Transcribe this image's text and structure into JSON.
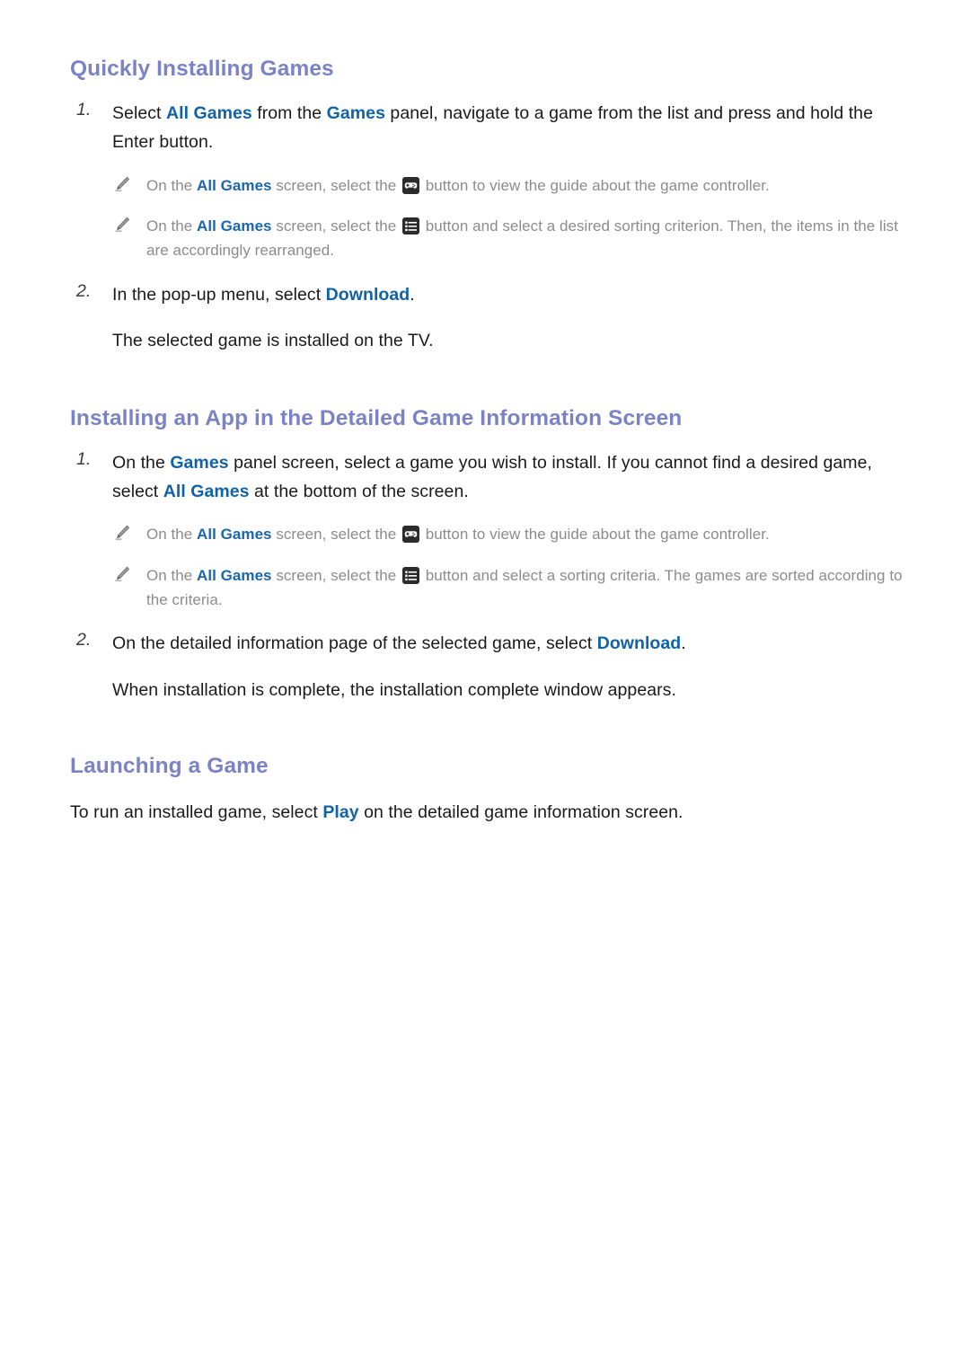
{
  "page": {
    "background": "#ffffff",
    "heading_color": "#7b83c6",
    "link_color": "#1063a8",
    "note_text_color": "#8c8c8c",
    "body_text_color": "#1a1a1a",
    "icon_background": "#2b2b2b"
  },
  "sections": [
    {
      "heading": "Quickly Installing Games",
      "steps": [
        {
          "marker": "1.",
          "parts": [
            {
              "text": "Select ",
              "style": "plain"
            },
            {
              "text": "All Games",
              "style": "link"
            },
            {
              "text": " from the ",
              "style": "plain"
            },
            {
              "text": "Games",
              "style": "link"
            },
            {
              "text": " panel, navigate to a game from the list and press and hold the Enter button.",
              "style": "plain"
            }
          ]
        },
        {
          "marker": "2.",
          "parts": [
            {
              "text": "In the pop-up menu, select ",
              "style": "plain"
            },
            {
              "text": "Download",
              "style": "link"
            },
            {
              "text": ".",
              "style": "plain"
            }
          ],
          "sub": "The selected game is installed on the TV."
        }
      ],
      "notes": [
        {
          "icon": "pencil-icon",
          "parts": [
            {
              "text": "On the ",
              "style": "plain"
            },
            {
              "text": "All Games",
              "style": "link"
            },
            {
              "text": " screen, select the ",
              "style": "plain"
            },
            {
              "text": "",
              "style": "icon",
              "icon": "gamepad-icon"
            },
            {
              "text": " button to view the guide about the game controller.",
              "style": "plain"
            }
          ]
        },
        {
          "icon": "pencil-icon",
          "parts": [
            {
              "text": "On the ",
              "style": "plain"
            },
            {
              "text": "All Games",
              "style": "link"
            },
            {
              "text": " screen, select the ",
              "style": "plain"
            },
            {
              "text": "",
              "style": "icon",
              "icon": "sort-list-icon"
            },
            {
              "text": " button and select a desired sorting criterion. Then, the items in the list are accordingly rearranged.",
              "style": "plain"
            }
          ]
        }
      ]
    },
    {
      "heading": "Installing an App in the Detailed Game Information Screen",
      "steps": [
        {
          "marker": "1.",
          "parts": [
            {
              "text": "On the ",
              "style": "plain"
            },
            {
              "text": "Games",
              "style": "link"
            },
            {
              "text": " panel screen, select a game you wish to install. If you cannot find a desired game, select ",
              "style": "plain"
            },
            {
              "text": "All Games",
              "style": "link"
            },
            {
              "text": " at the bottom of the screen.",
              "style": "plain"
            }
          ]
        },
        {
          "marker": "2.",
          "parts": [
            {
              "text": "On the detailed information page of the selected game, select ",
              "style": "plain"
            },
            {
              "text": "Download",
              "style": "link"
            },
            {
              "text": ".",
              "style": "plain"
            }
          ],
          "sub": "When installation is complete, the installation complete window appears."
        }
      ],
      "notes": [
        {
          "icon": "pencil-icon",
          "parts": [
            {
              "text": "On the ",
              "style": "plain"
            },
            {
              "text": "All Games",
              "style": "link"
            },
            {
              "text": " screen, select the ",
              "style": "plain"
            },
            {
              "text": "",
              "style": "icon",
              "icon": "gamepad-icon"
            },
            {
              "text": " button to view the guide about the game controller.",
              "style": "plain"
            }
          ]
        },
        {
          "icon": "pencil-icon",
          "parts": [
            {
              "text": "On the ",
              "style": "plain"
            },
            {
              "text": "All Games",
              "style": "link"
            },
            {
              "text": " screen, select the ",
              "style": "plain"
            },
            {
              "text": "",
              "style": "icon",
              "icon": "sort-list-icon"
            },
            {
              "text": " button and select a sorting criteria. The games are sorted according to the criteria.",
              "style": "plain"
            }
          ]
        }
      ]
    },
    {
      "heading": "Launching a Game",
      "steps": [],
      "notes": [],
      "paragraph": {
        "parts": [
          {
            "text": "To run an installed game, select ",
            "style": "plain"
          },
          {
            "text": "Play",
            "style": "link"
          },
          {
            "text": " on the detailed game information screen.",
            "style": "plain"
          }
        ]
      }
    }
  ]
}
